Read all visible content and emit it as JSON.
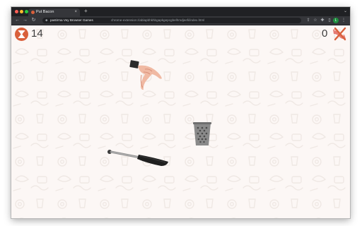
{
  "browser": {
    "tab_title": "Put Bacon",
    "tab_close_icon": "close-icon",
    "new_tab_icon": "plus-icon",
    "tab_menu_icon": "chevron-down-icon",
    "extension_name": "pastirma Vey Browser Games",
    "url": "chrome-extension://ablapbhkhbgapkgepcgbelhmdjeefi/index.html",
    "profile_initial": "L"
  },
  "game": {
    "timer_value": "14",
    "score_value": "0",
    "timer_icon": "hourglass-icon",
    "score_icon": "bacon-icon",
    "colors": {
      "accent": "#d9603b",
      "text": "#3b3b3b",
      "background": "#fcf7f5",
      "pattern": "#efe8e4"
    }
  }
}
